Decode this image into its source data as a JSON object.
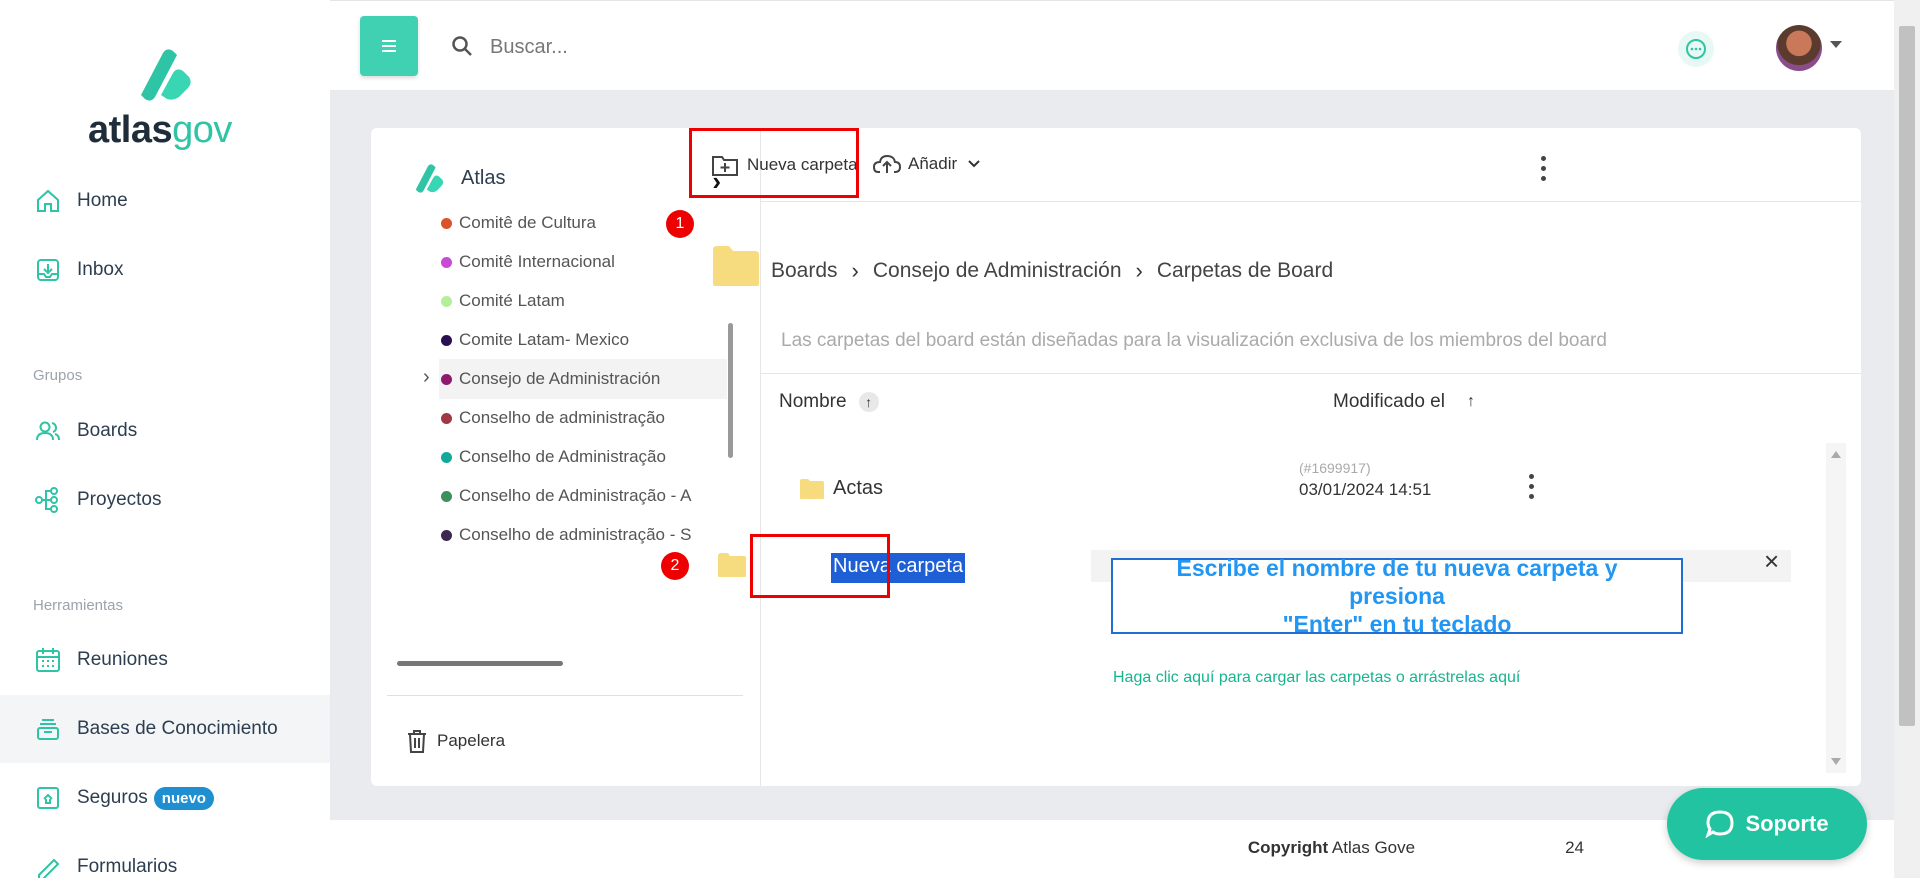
{
  "brand": {
    "name_bold": "atlas",
    "name_light": "gov",
    "primary_color": "#2ec4a5"
  },
  "sidebar": {
    "items": [
      {
        "label": "Home",
        "icon": "home-icon"
      },
      {
        "label": "Inbox",
        "icon": "inbox-icon"
      }
    ],
    "groups_label": "Grupos",
    "group_items": [
      {
        "label": "Boards",
        "icon": "users-icon"
      },
      {
        "label": "Proyectos",
        "icon": "nodes-icon"
      }
    ],
    "tools_label": "Herramientas",
    "tool_items": [
      {
        "label": "Reuniones",
        "icon": "calendar-icon"
      },
      {
        "label": "Bases de Conocimiento",
        "icon": "stack-icon"
      },
      {
        "label": "Seguros",
        "icon": "safe-icon",
        "badge": "nuevo"
      },
      {
        "label": "Formularios",
        "icon": "form-icon"
      }
    ]
  },
  "header": {
    "search_placeholder": "Buscar...",
    "chat_icon": "chat-icon",
    "avatar_alt": "user-avatar"
  },
  "tree": {
    "root_label": "Atlas",
    "items": [
      {
        "label": "Comitê de Cultura",
        "color": "#d9532c"
      },
      {
        "label": "Comitê Internacional",
        "color": "#c94ad6"
      },
      {
        "label": "Comité Latam",
        "color": "#b3ef9a"
      },
      {
        "label": "Comite Latam- Mexico",
        "color": "#2a1050"
      },
      {
        "label": "Consejo de Administración",
        "color": "#8e1a6b",
        "selected": true
      },
      {
        "label": "Conselho de administração",
        "color": "#a03845"
      },
      {
        "label": "Conselho de Administração",
        "color": "#13a89a"
      },
      {
        "label": "Conselho de Administração - A",
        "color": "#3e8f5e"
      },
      {
        "label": "Conselho de administração - S",
        "color": "#3a2a50"
      }
    ],
    "trash_label": "Papelera"
  },
  "toolbar": {
    "new_folder_label": "Nueva carpeta",
    "add_label": "Añadir"
  },
  "steps": {
    "one": "1",
    "two": "2"
  },
  "breadcrumb": [
    "Boards",
    "Consejo de Administración",
    "Carpetas de Board"
  ],
  "subtitle": "Las carpetas del board están diseñadas para la visualización exclusiva de los miembros del board",
  "table": {
    "col_name": "Nombre",
    "col_modified": "Modificado el",
    "rows": [
      {
        "name": "Actas",
        "id": "(#1699917)",
        "date": "03/01/2024 14:51"
      }
    ],
    "new_folder_value": "Nueva carpeta"
  },
  "hint": {
    "line1": "Escribe el nombre de tu nueva carpeta y presiona",
    "line2": "\"Enter\" en tu teclado"
  },
  "drop_hint": "Haga clic aquí para cargar las carpetas o arrástrelas aquí",
  "footer": {
    "copyright_bold": "Copyright",
    "copyright_rest": " Atlas Gove",
    "year_tail": "24"
  },
  "support_label": "Soporte"
}
